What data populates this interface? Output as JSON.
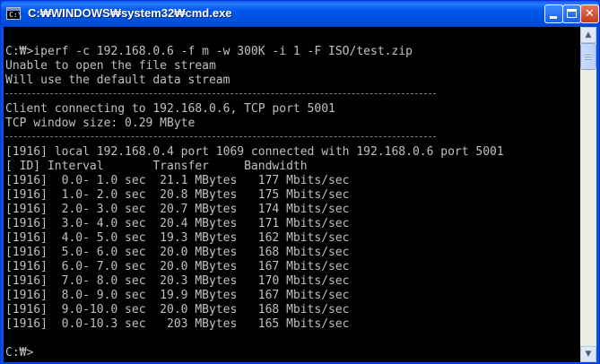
{
  "window": {
    "title": "C:₩WINDOWS₩system32₩cmd.exe",
    "icon": "console-window-icon",
    "icon_glyph": "C:\\"
  },
  "controls": {
    "minimize": "minimize-icon",
    "maximize": "maximize-icon",
    "close": "close-icon",
    "close_glyph": "✕"
  },
  "scrollbar": {
    "up_glyph": "▲",
    "down_glyph": "▼"
  },
  "console": {
    "lines": [
      {
        "kind": "text",
        "text": "C:₩>iperf -c 192.168.0.6 -f m -w 300K -i 1 -F ISO/test.zip"
      },
      {
        "kind": "text",
        "text": "Unable to open the file stream"
      },
      {
        "kind": "text",
        "text": "Will use the default data stream"
      },
      {
        "kind": "rule"
      },
      {
        "kind": "text",
        "text": "Client connecting to 192.168.0.6, TCP port 5001"
      },
      {
        "kind": "text",
        "text": "TCP window size: 0.29 MByte"
      },
      {
        "kind": "rule"
      },
      {
        "kind": "text",
        "text": "[1916] local 192.168.0.4 port 1069 connected with 192.168.0.6 port 5001"
      },
      {
        "kind": "text",
        "text": "[ ID] Interval       Transfer     Bandwidth"
      },
      {
        "kind": "text",
        "text": "[1916]  0.0- 1.0 sec  21.1 MBytes   177 Mbits/sec"
      },
      {
        "kind": "text",
        "text": "[1916]  1.0- 2.0 sec  20.8 MBytes   175 Mbits/sec"
      },
      {
        "kind": "text",
        "text": "[1916]  2.0- 3.0 sec  20.7 MBytes   174 Mbits/sec"
      },
      {
        "kind": "text",
        "text": "[1916]  3.0- 4.0 sec  20.4 MBytes   171 Mbits/sec"
      },
      {
        "kind": "text",
        "text": "[1916]  4.0- 5.0 sec  19.3 MBytes   162 Mbits/sec"
      },
      {
        "kind": "text",
        "text": "[1916]  5.0- 6.0 sec  20.0 MBytes   168 Mbits/sec"
      },
      {
        "kind": "text",
        "text": "[1916]  6.0- 7.0 sec  20.0 MBytes   167 Mbits/sec"
      },
      {
        "kind": "text",
        "text": "[1916]  7.0- 8.0 sec  20.3 MBytes   170 Mbits/sec"
      },
      {
        "kind": "text",
        "text": "[1916]  8.0- 9.0 sec  19.9 MBytes   167 Mbits/sec"
      },
      {
        "kind": "text",
        "text": "[1916]  9.0-10.0 sec  20.0 MBytes   168 Mbits/sec"
      },
      {
        "kind": "text",
        "text": "[1916]  0.0-10.3 sec   203 MBytes   165 Mbits/sec"
      },
      {
        "kind": "blank"
      },
      {
        "kind": "text",
        "text": "C:₩>"
      }
    ]
  }
}
